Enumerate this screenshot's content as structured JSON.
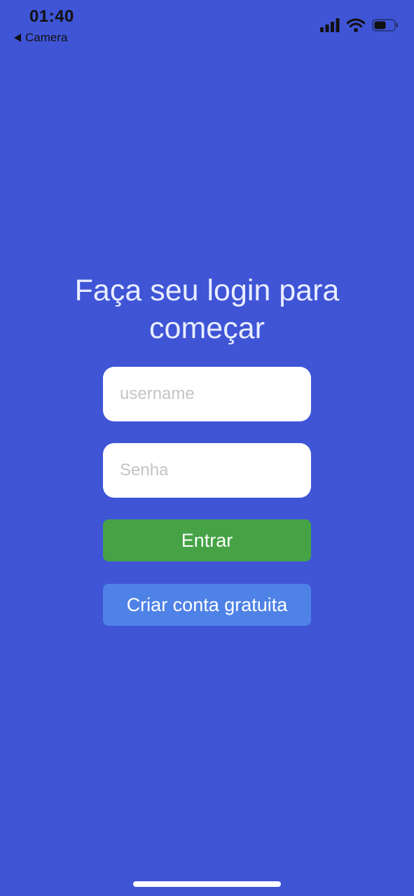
{
  "status_bar": {
    "time": "01:40",
    "back_label": "Camera"
  },
  "login": {
    "title_line1": "Faça seu login para",
    "title_line2": "começar",
    "username_placeholder": "username",
    "password_placeholder": "Senha",
    "login_button": "Entrar",
    "signup_button": "Criar conta gratuita"
  },
  "colors": {
    "background": "#3f55d6",
    "login_button": "#45a346",
    "signup_button": "#4f82e6",
    "input_background": "#ffffff"
  }
}
